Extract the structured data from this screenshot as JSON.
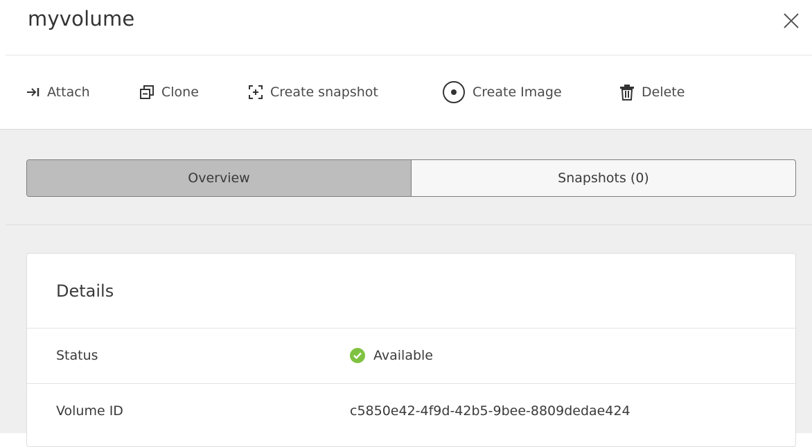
{
  "header": {
    "title": "myvolume",
    "close_icon": "close-icon"
  },
  "toolbar": {
    "items": [
      {
        "label": "Attach",
        "icon": "attach-arrow-icon"
      },
      {
        "label": "Clone",
        "icon": "clone-icon"
      },
      {
        "label": "Create snapshot",
        "icon": "snapshot-icon"
      },
      {
        "label": "Create Image",
        "icon": "disc-image-icon"
      },
      {
        "label": "Delete",
        "icon": "trash-icon"
      }
    ]
  },
  "tabs": [
    {
      "label": "Overview",
      "active": true
    },
    {
      "label": "Snapshots (0)",
      "active": false
    }
  ],
  "details": {
    "title": "Details",
    "rows": [
      {
        "label": "Status",
        "value": "Available",
        "status_color": "#7fc241"
      },
      {
        "label": "Volume ID",
        "value": "c5850e42-4f9d-42b5-9bee-8809dedae424"
      }
    ]
  },
  "colors": {
    "active_tab": "#bdbdbd",
    "status_ok": "#7fc241",
    "panel_bg": "#efefef"
  }
}
